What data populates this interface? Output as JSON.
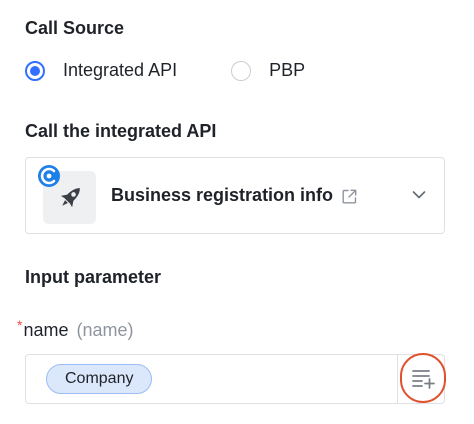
{
  "call_source": {
    "title": "Call Source",
    "options": [
      {
        "label": "Integrated API",
        "checked": true
      },
      {
        "label": "PBP",
        "checked": false
      }
    ]
  },
  "integrated_api": {
    "title": "Call the integrated API",
    "selected_name": "Business registration info",
    "logo_icon": "rocket-icon",
    "badge_icon": "integration-badge-icon"
  },
  "input_parameter": {
    "title": "Input parameter",
    "param": {
      "required_mark": "*",
      "label": "name",
      "alias": "(name)",
      "value_tag": "Company"
    },
    "insert_button_icon": "insert-variable-icon"
  },
  "colors": {
    "accent": "#3370ff",
    "highlight_circle": "#e0512e",
    "required": "#f54a45",
    "tag_bg": "#dbe7fb"
  }
}
